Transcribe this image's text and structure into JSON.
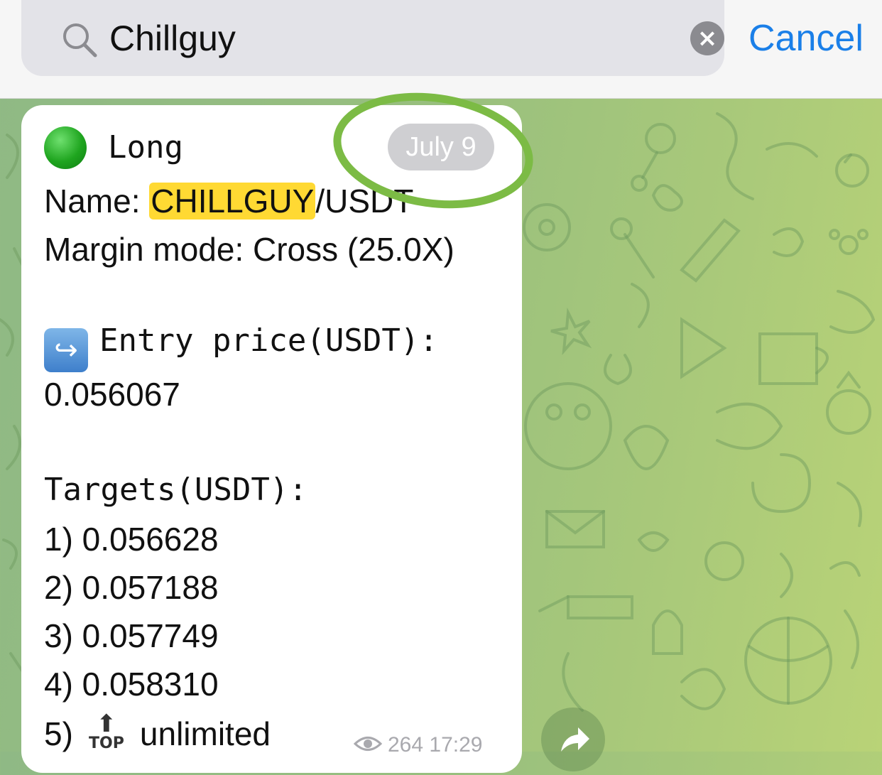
{
  "search": {
    "query": "Chillguy",
    "icon": "search-icon",
    "clear_icon": "clear-icon",
    "cancel_label": "Cancel"
  },
  "message": {
    "direction": "Long",
    "status_icon": "green-circle-icon",
    "date": "July 9",
    "name_label": "Name: ",
    "name_highlight": "CHILLGUY",
    "name_rest": "/USDT",
    "margin_mode": "Margin mode: Cross (25.0X)",
    "entry_icon": "right-arrow-curving-left-icon",
    "entry_label": "Entry price(USDT):",
    "entry_value": "0.056067",
    "targets_label": "Targets(USDT):",
    "targets": [
      "1) 0.056628",
      "2) 0.057188",
      "3) 0.057749",
      "4) 0.058310"
    ],
    "target5_prefix": "5)",
    "target5_icon": "top-arrow-icon",
    "target5_icon_text": "TOP",
    "target5_value": "unlimited",
    "views": "264",
    "time": "17:29"
  },
  "colors": {
    "accent": "#1a7fe8",
    "highlight": "#ffd933",
    "annotation_ring": "#7cbb45"
  }
}
